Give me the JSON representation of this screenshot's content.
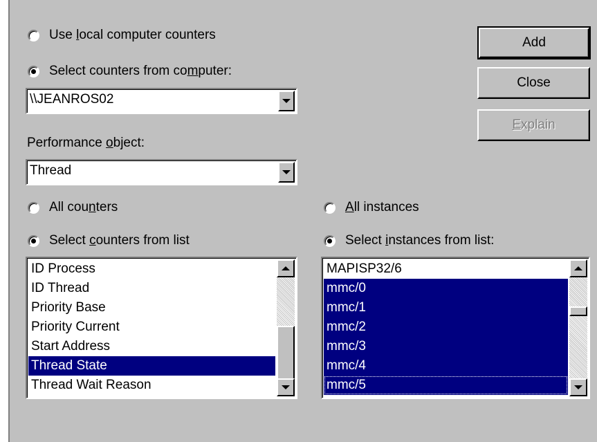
{
  "window": {
    "computer_source": {
      "local_option": {
        "pre": "Use ",
        "key": "l",
        "post": "ocal computer counters"
      },
      "remote_option": {
        "pre": "Select counters from co",
        "key": "m",
        "post": "puter:"
      },
      "selected": "remote",
      "computer_value": "\\\\JEANROS02"
    },
    "performance_object": {
      "label_pre": "Performance ",
      "label_key": "o",
      "label_post": "bject:",
      "value": "Thread"
    },
    "counters": {
      "all_option": {
        "pre": "All cou",
        "key": "n",
        "post": "ters"
      },
      "list_option": {
        "pre": "Select ",
        "key": "c",
        "post": "ounters from list"
      },
      "selected": "list",
      "items": [
        "ID Process",
        "ID Thread",
        "Priority Base",
        "Priority Current",
        "Start Address",
        "Thread State",
        "Thread Wait Reason"
      ],
      "selected_item": "Thread State"
    },
    "instances": {
      "all_option": {
        "pre": "",
        "key": "A",
        "post": "ll instances"
      },
      "list_option": {
        "pre": "Select ",
        "key": "i",
        "post": "nstances from list:"
      },
      "selected": "list",
      "items": [
        "MAPISP32/6",
        "mmc/0",
        "mmc/1",
        "mmc/2",
        "mmc/3",
        "mmc/4",
        "mmc/5"
      ],
      "selected_items": [
        "mmc/0",
        "mmc/1",
        "mmc/2",
        "mmc/3",
        "mmc/4",
        "mmc/5"
      ],
      "focused_item": "mmc/5"
    },
    "buttons": {
      "add": "Add",
      "close": "Close",
      "explain_key": "E",
      "explain_rest": "xplain"
    }
  }
}
